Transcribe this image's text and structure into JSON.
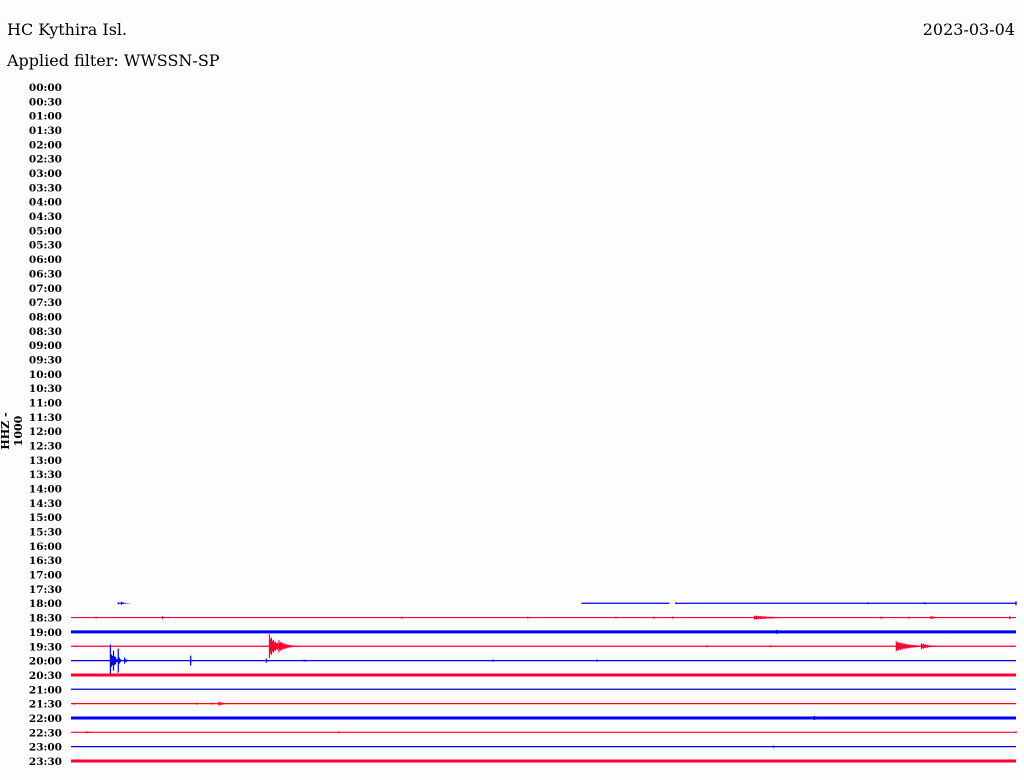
{
  "header": {
    "station": "HC Kythira Isl.",
    "filter": "Applied filter: WWSSN-SP",
    "date": "2023-03-04"
  },
  "chart_data": {
    "type": "line",
    "title": "HC Kythira Isl.",
    "ylabel": "HHZ - 1000",
    "row_minutes": 30,
    "tick_labels": [
      "00:00",
      "00:30",
      "01:00",
      "01:30",
      "02:00",
      "02:30",
      "03:00",
      "03:30",
      "04:00",
      "04:30",
      "05:00",
      "05:30",
      "06:00",
      "06:30",
      "07:00",
      "07:30",
      "08:00",
      "08:30",
      "09:00",
      "09:30",
      "10:00",
      "10:30",
      "11:00",
      "11:30",
      "12:00",
      "12:30",
      "13:00",
      "13:30",
      "14:00",
      "14:30",
      "15:00",
      "15:30",
      "16:00",
      "16:30",
      "17:00",
      "17:30",
      "18:00",
      "18:30",
      "19:00",
      "19:30",
      "20:00",
      "20:30",
      "21:00",
      "21:30",
      "22:00",
      "22:30",
      "23:00",
      "23:30"
    ],
    "colors": {
      "red": "#ff0033",
      "blue": "#0000ff"
    },
    "traces": [
      {
        "row": "18:00",
        "color": "#0000ff",
        "heavy": false,
        "start_min": 16.2,
        "gaps": [
          [
            19.0,
            19.2
          ]
        ],
        "events": [
          [
            1.5,
            1,
            0.3
          ],
          [
            1.6,
            1.5,
            0.3
          ],
          [
            19.2,
            1,
            0.1
          ],
          [
            25.3,
            1,
            0.1
          ],
          [
            27.1,
            1,
            0.1
          ],
          [
            30,
            2,
            0.05
          ]
        ]
      },
      {
        "row": "18:30",
        "color": "#ff0033",
        "heavy": false,
        "start_min": 0,
        "gaps": [],
        "events": [
          [
            0.8,
            1,
            0.1
          ],
          [
            2.9,
            1.5,
            0.1
          ],
          [
            10.5,
            1,
            0.4
          ],
          [
            14.5,
            1,
            0.3
          ],
          [
            17.3,
            1,
            0.2
          ],
          [
            18.5,
            1,
            0.4
          ],
          [
            19.1,
            1,
            0.2
          ],
          [
            21.7,
            2,
            1.8
          ],
          [
            25.7,
            1,
            0.6
          ],
          [
            27.3,
            1.5,
            0.6
          ],
          [
            29.8,
            1.5,
            0.4
          ],
          [
            26.6,
            1,
            0.3
          ]
        ]
      },
      {
        "row": "19:00",
        "color": "#0000ff",
        "heavy": true,
        "start_min": 0,
        "gaps": [],
        "events": [
          [
            1.4,
            1,
            0.1
          ],
          [
            2.5,
            1,
            0.1
          ],
          [
            12.5,
            1,
            0.1
          ],
          [
            22.4,
            2,
            0.5
          ],
          [
            27.8,
            1.5,
            0.1
          ]
        ]
      },
      {
        "row": "19:30",
        "color": "#ff0033",
        "heavy": false,
        "start_min": 0,
        "gaps": [],
        "events": [
          [
            6.3,
            12,
            0.6
          ],
          [
            6.6,
            6,
            0.7
          ],
          [
            20.2,
            1,
            0.1
          ],
          [
            22.2,
            1,
            0.1
          ],
          [
            26.2,
            5,
            1.2
          ],
          [
            27.0,
            3,
            0.8
          ]
        ]
      },
      {
        "row": "20:00",
        "color": "#0000ff",
        "heavy": false,
        "start_min": 0,
        "gaps": [],
        "events": [
          [
            1.25,
            16,
            0.15
          ],
          [
            1.35,
            10,
            0.2
          ],
          [
            1.5,
            12,
            0.1
          ],
          [
            1.7,
            3,
            0.2
          ],
          [
            3.8,
            5,
            0.05
          ],
          [
            6.2,
            2,
            0.15
          ],
          [
            7.4,
            1,
            0.5
          ],
          [
            13.4,
            1,
            0.2
          ],
          [
            16.7,
            1,
            0.1
          ]
        ]
      },
      {
        "row": "20:30",
        "color": "#ff0033",
        "heavy": true,
        "start_min": 0,
        "gaps": [],
        "events": []
      },
      {
        "row": "21:00",
        "color": "#0000cc",
        "heavy": false,
        "start_min": 0,
        "gaps": [],
        "events": []
      },
      {
        "row": "21:30",
        "color": "#ff0033",
        "heavy": false,
        "start_min": 0,
        "gaps": [],
        "events": [
          [
            0.1,
            1,
            0.1
          ],
          [
            4.0,
            1,
            0.2
          ],
          [
            4.5,
            1,
            0.1
          ],
          [
            4.7,
            2,
            0.5
          ]
        ]
      },
      {
        "row": "22:00",
        "color": "#0000ff",
        "heavy": true,
        "start_min": 0,
        "gaps": [],
        "events": [
          [
            23.6,
            2,
            0.7
          ]
        ]
      },
      {
        "row": "22:30",
        "color": "#ff0033",
        "heavy": false,
        "start_min": 0,
        "gaps": [],
        "events": [
          [
            0.5,
            1,
            0.5
          ],
          [
            8.5,
            1,
            0.1
          ],
          [
            30,
            1,
            0.05
          ]
        ]
      },
      {
        "row": "23:00",
        "color": "#0000ff",
        "heavy": false,
        "start_min": 0,
        "gaps": [],
        "events": [
          [
            22.3,
            1,
            0.3
          ]
        ]
      },
      {
        "row": "23:30",
        "color": "#ff0033",
        "heavy": true,
        "start_min": 0,
        "gaps": [],
        "events": []
      }
    ]
  }
}
